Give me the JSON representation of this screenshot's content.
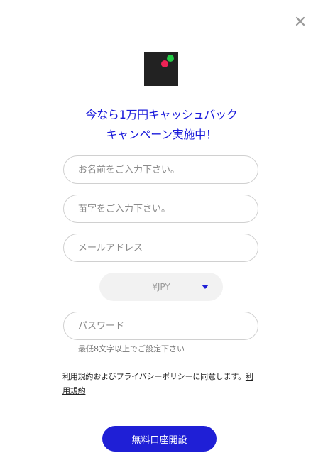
{
  "modal": {
    "close_label": "×",
    "headline_line1": "今なら1万円キャッシュバック",
    "headline_line2": "キャンペーン実施中！"
  },
  "form": {
    "first_name_placeholder": "お名前をご入力下さい。",
    "last_name_placeholder": "苗字をご入力下さい。",
    "email_placeholder": "メールアドレス",
    "currency_selected": "¥JPY",
    "password_placeholder": "パスワード",
    "password_hint": "最低8文字以上でご設定下さい",
    "agree_text": "利用規約およびプライバシーポリシーに同意します。",
    "agree_link": "利用規約",
    "submit_label": "無料口座開設"
  },
  "colors": {
    "accent": "#1f1fd6",
    "headline": "#1a1adb",
    "logo_bg": "#222222",
    "logo_dot_green": "#22cc44",
    "logo_dot_red": "#ee2255"
  },
  "icons": {
    "close": "close-icon",
    "logo": "brand-logo",
    "dropdown": "caret-down-icon"
  }
}
